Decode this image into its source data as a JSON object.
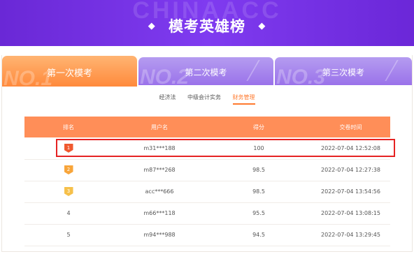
{
  "banner": {
    "watermark": "CHINAACC",
    "title": "模考英雄榜",
    "diamond": "◆"
  },
  "tabs": [
    {
      "label": "第一次模考",
      "watermark": "NO.1",
      "active": true
    },
    {
      "label": "第二次模考",
      "watermark": "NO.2",
      "active": false
    },
    {
      "label": "第三次模考",
      "watermark": "NO.3",
      "active": false
    }
  ],
  "subtabs": [
    {
      "label": "经济法",
      "active": false
    },
    {
      "label": "中级会计实务",
      "active": false
    },
    {
      "label": "财务管理",
      "active": true
    }
  ],
  "table": {
    "headers": [
      "排名",
      "用户名",
      "得分",
      "交卷时间"
    ],
    "rows": [
      {
        "rank": "1",
        "user": "m31***188",
        "score": "100",
        "time": "2022-07-04 12:52:08"
      },
      {
        "rank": "2",
        "user": "m87***268",
        "score": "98.5",
        "time": "2022-07-04 12:27:38"
      },
      {
        "rank": "3",
        "user": "acc***666",
        "score": "98.5",
        "time": "2022-07-04 13:54:56"
      },
      {
        "rank": "4",
        "user": "m66***118",
        "score": "95.5",
        "time": "2022-07-04 13:08:15"
      },
      {
        "rank": "5",
        "user": "m94***988",
        "score": "94.5",
        "time": "2022-07-04 13:29:45"
      }
    ]
  },
  "colors": {
    "banner": "#7232e0",
    "active_tab": "#ff8a3c",
    "inactive_tab": "#9a72ea",
    "table_header": "#ff8e58",
    "highlight_border": "#e52222"
  }
}
